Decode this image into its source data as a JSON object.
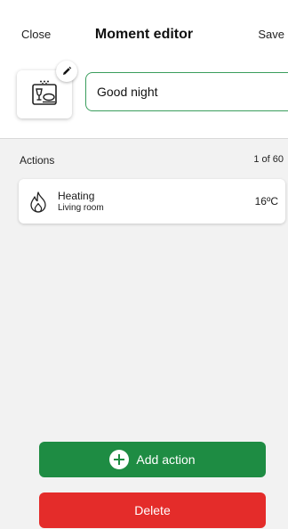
{
  "header": {
    "close_label": "Close",
    "title": "Moment editor",
    "save_label": "Save"
  },
  "moment": {
    "icon": "dinner-plate-wine-icon",
    "edit_icon": "pencil-icon",
    "name_value": "Good night"
  },
  "actions": {
    "section_label": "Actions",
    "count_label": "1 of 60",
    "items": [
      {
        "icon": "flame-icon",
        "name": "Heating",
        "room": "Living room",
        "value": "16ºC"
      }
    ]
  },
  "footer": {
    "add_label": "Add action",
    "delete_label": "Delete"
  },
  "colors": {
    "accent_green": "#1e8c43",
    "input_border": "#3a9d5d",
    "danger_red": "#e42c2a",
    "content_bg": "#f2f2f2"
  }
}
